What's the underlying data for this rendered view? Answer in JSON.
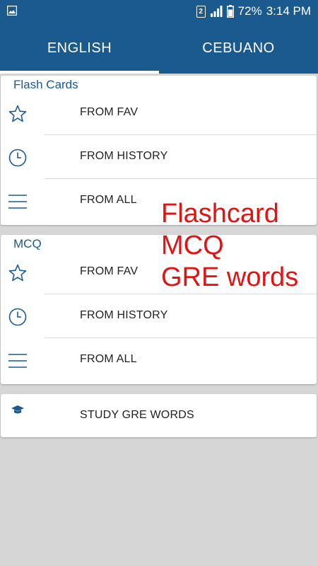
{
  "status_bar": {
    "sim_label": "2",
    "battery": "72%",
    "time": "3:14 PM"
  },
  "tabs": [
    {
      "label": "ENGLISH",
      "selected": true
    },
    {
      "label": "CEBUANO",
      "selected": false
    }
  ],
  "flash_cards": {
    "title": "Flash Cards",
    "items": [
      {
        "icon": "star-outline-icon",
        "label": "FROM FAV"
      },
      {
        "icon": "clock-icon",
        "label": "FROM HISTORY"
      },
      {
        "icon": "list-icon",
        "label": "FROM ALL"
      }
    ]
  },
  "mcq": {
    "title": "MCQ",
    "items": [
      {
        "icon": "star-outline-icon",
        "label": "FROM FAV"
      },
      {
        "icon": "clock-icon",
        "label": "FROM HISTORY"
      },
      {
        "icon": "list-icon",
        "label": "FROM ALL"
      }
    ]
  },
  "gre": {
    "icon": "graduation-cap-icon",
    "label": "STUDY GRE WORDS"
  },
  "overlay_text": [
    "Flashcard",
    "MCQ",
    "GRE words"
  ],
  "colors": {
    "primary": "#1a5a8f",
    "accent_text": "#1a5a8f",
    "icon": "#1a5a8f",
    "overlay": "#e01414",
    "background": "#d6d6d6"
  }
}
